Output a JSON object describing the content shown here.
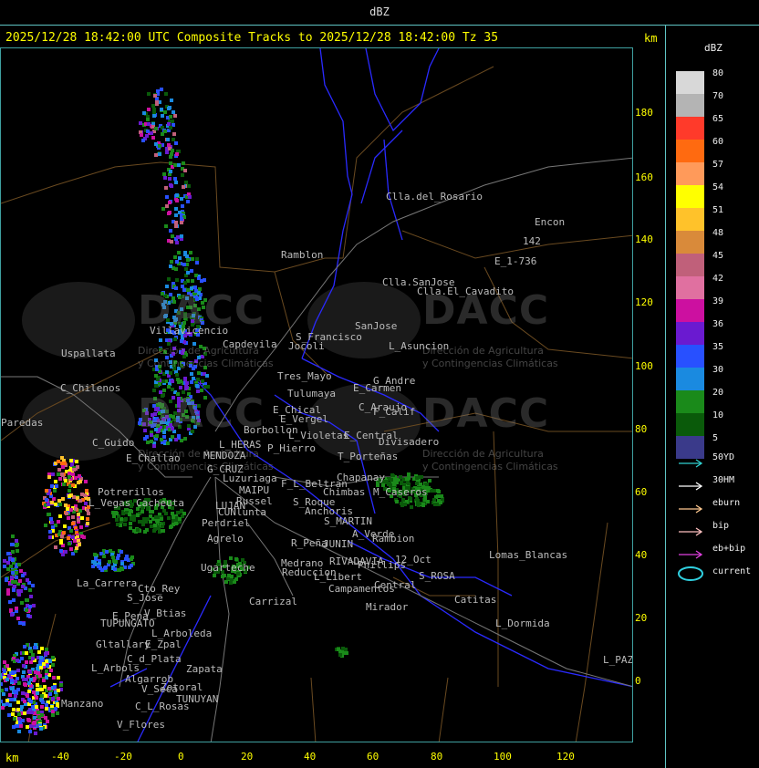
{
  "app": {
    "title": "dBZ"
  },
  "header": {
    "line": "2025/12/28 18:42:00 UTC Composite Tracks to 2025/12/28 18:42:00 Tz 35",
    "unit_top": "km",
    "unit_bottom": "km"
  },
  "axes": {
    "y_ticks": [
      "180",
      "160",
      "140",
      "120",
      "100",
      "80",
      "60",
      "40",
      "20",
      "0"
    ],
    "x_ticks": [
      "-40",
      "-20",
      "0",
      "20",
      "40",
      "60",
      "80",
      "100",
      "120"
    ]
  },
  "legend": {
    "title": "dBZ",
    "scale": [
      {
        "label": "80",
        "color": "#d8d8d8"
      },
      {
        "label": "70",
        "color": "#b4b4b4"
      },
      {
        "label": "65",
        "color": "#ff3a2a"
      },
      {
        "label": "60",
        "color": "#ff6a10"
      },
      {
        "label": "57",
        "color": "#ff9a5a"
      },
      {
        "label": "54",
        "color": "#ffff00"
      },
      {
        "label": "51",
        "color": "#ffc22a"
      },
      {
        "label": "48",
        "color": "#d98a3a"
      },
      {
        "label": "45",
        "color": "#c0607a"
      },
      {
        "label": "42",
        "color": "#e070a0"
      },
      {
        "label": "39",
        "color": "#cc10a0"
      },
      {
        "label": "36",
        "color": "#6a1ad0"
      },
      {
        "label": "35",
        "color": "#2850ff"
      },
      {
        "label": "30",
        "color": "#1a8ae0"
      },
      {
        "label": "20",
        "color": "#1a8a1a"
      },
      {
        "label": "10",
        "color": "#0a5a0a"
      },
      {
        "label": "5",
        "color": "#3a3a8a"
      }
    ],
    "tracks": [
      {
        "label": "50YD",
        "color": "#30d0d0"
      },
      {
        "label": "30HM",
        "color": "#ffffff"
      },
      {
        "label": "eburn",
        "color": "#ffc890"
      },
      {
        "label": "bip",
        "color": "#ffc0c0"
      },
      {
        "label": "eb+bip",
        "color": "#e040e0"
      },
      {
        "label": "current",
        "color": "#30d0e0"
      }
    ]
  },
  "places": [
    {
      "name": "Clla.del_Rosario"
    },
    {
      "name": "Encon"
    },
    {
      "name": "142"
    },
    {
      "name": "E_1-736"
    },
    {
      "name": "Ramblon"
    },
    {
      "name": "Clla.SanJose"
    },
    {
      "name": "Clla.El_Cavadito"
    },
    {
      "name": "Villavicencio"
    },
    {
      "name": "Uspallata"
    },
    {
      "name": "Capdevila"
    },
    {
      "name": "S_Francisco"
    },
    {
      "name": "SanJose"
    },
    {
      "name": "L_Asuncion"
    },
    {
      "name": "Jocoli"
    },
    {
      "name": "Tres_Mayo"
    },
    {
      "name": "C_Chilenos"
    },
    {
      "name": "Tulumaya"
    },
    {
      "name": "G_Andre"
    },
    {
      "name": "E_Carmen"
    },
    {
      "name": "E_Chical"
    },
    {
      "name": "C_Araujo"
    },
    {
      "name": "F_Calif"
    },
    {
      "name": "E_Vergel"
    },
    {
      "name": "Paredas"
    },
    {
      "name": "Borbollon"
    },
    {
      "name": "L_Violetas"
    },
    {
      "name": "E_Central"
    },
    {
      "name": "Divisadero"
    },
    {
      "name": "C_Guido"
    },
    {
      "name": "L_HERAS"
    },
    {
      "name": "P_Hierro"
    },
    {
      "name": "E_Challao"
    },
    {
      "name": "MENDOZA"
    },
    {
      "name": "T_Porteñas"
    },
    {
      "name": "G_CRUZ"
    },
    {
      "name": "Luzuriaga"
    },
    {
      "name": "F_L_Beltran"
    },
    {
      "name": "Chapanay"
    },
    {
      "name": "Chimbas"
    },
    {
      "name": "M_Caseros"
    },
    {
      "name": "Potrerillos"
    },
    {
      "name": "L_Vegas"
    },
    {
      "name": "Cacheuta"
    },
    {
      "name": "MAIPU"
    },
    {
      "name": "Russel"
    },
    {
      "name": "S_Roque"
    },
    {
      "name": "LUJAN"
    },
    {
      "name": "CUNlunta"
    },
    {
      "name": "Perdriel"
    },
    {
      "name": "Anchoris"
    },
    {
      "name": "S_MARTIN"
    },
    {
      "name": "A_Verde"
    },
    {
      "name": "Agrelo"
    },
    {
      "name": "Rambion"
    },
    {
      "name": "R_Peña"
    },
    {
      "name": "JUNIN"
    },
    {
      "name": "Lomas_Blancas"
    },
    {
      "name": "Ugarteche"
    },
    {
      "name": "Medrano"
    },
    {
      "name": "RIVADAVIA"
    },
    {
      "name": "12_Oct"
    },
    {
      "name": "Reduccion"
    },
    {
      "name": "Phillips"
    },
    {
      "name": "La_Carrera"
    },
    {
      "name": "Cto_Rey"
    },
    {
      "name": "L_Libert"
    },
    {
      "name": "S_ROSA"
    },
    {
      "name": "S_Jose"
    },
    {
      "name": "Carrizal"
    },
    {
      "name": "Campamentos"
    },
    {
      "name": "Central"
    },
    {
      "name": "Catitas"
    },
    {
      "name": "Mirador"
    },
    {
      "name": "V_Btias"
    },
    {
      "name": "E_Pena"
    },
    {
      "name": "TUPUNGATO"
    },
    {
      "name": "L_Dormida"
    },
    {
      "name": "L_Arboleda"
    },
    {
      "name": "Gltallary"
    },
    {
      "name": "E_Zpal"
    },
    {
      "name": "C_d_Plata"
    },
    {
      "name": "L_Arbols"
    },
    {
      "name": "Zapata"
    },
    {
      "name": "Algarrob"
    },
    {
      "name": "V_Seca"
    },
    {
      "name": "Zotoral"
    },
    {
      "name": "TUNUYAN"
    },
    {
      "name": "C_L_Rosas"
    },
    {
      "name": "V_Flores"
    },
    {
      "name": "L_PAZ"
    },
    {
      "name": "Manzano"
    }
  ],
  "watermark": {
    "text": "DACC",
    "subtitle_1": "Dirección de Agricultura",
    "subtitle_2": "y Contingencias Climáticas"
  }
}
